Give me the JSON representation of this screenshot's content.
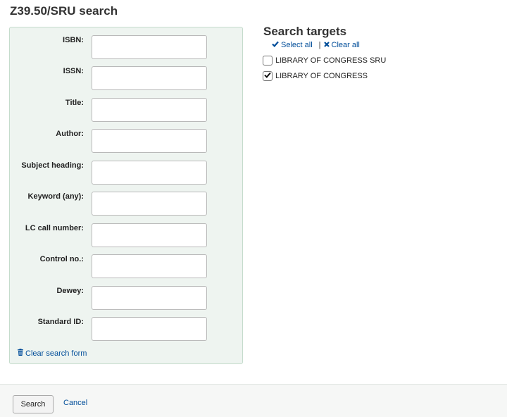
{
  "page": {
    "title": "Z39.50/SRU search"
  },
  "search_form": {
    "fields": [
      {
        "label": "ISBN:",
        "value": ""
      },
      {
        "label": "ISSN:",
        "value": ""
      },
      {
        "label": "Title:",
        "value": ""
      },
      {
        "label": "Author:",
        "value": ""
      },
      {
        "label": "Subject heading:",
        "value": ""
      },
      {
        "label": "Keyword (any):",
        "value": ""
      },
      {
        "label": "LC call number:",
        "value": ""
      },
      {
        "label": "Control no.:",
        "value": ""
      },
      {
        "label": "Dewey:",
        "value": ""
      },
      {
        "label": "Standard ID:",
        "value": ""
      }
    ],
    "clear_label": "Clear search form",
    "clear_icon": "trash-icon"
  },
  "targets": {
    "title": "Search targets",
    "select_all_label": "Select all",
    "select_all_icon": "checkmark-icon",
    "clear_all_label": "Clear all",
    "clear_all_icon": "x-icon",
    "separator": "|",
    "items": [
      {
        "label": "LIBRARY OF CONGRESS SRU",
        "checked": false
      },
      {
        "label": "LIBRARY OF CONGRESS",
        "checked": true
      }
    ]
  },
  "footer": {
    "search_label": "Search",
    "cancel_label": "Cancel"
  },
  "colors": {
    "link": "#004d99",
    "panel_bg": "#eef4f0",
    "panel_border": "#c5dccc"
  }
}
